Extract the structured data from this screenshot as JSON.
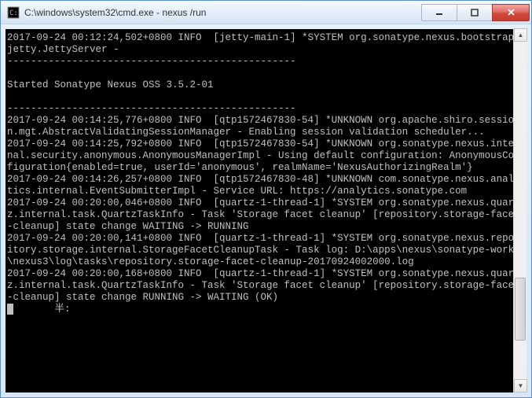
{
  "window": {
    "title": "C:\\windows\\system32\\cmd.exe - nexus  /run"
  },
  "terminal": {
    "lines": [
      "2017-09-24 00:12:24,502+0800 INFO  [jetty-main-1] *SYSTEM org.sonatype.nexus.bootstrap.jetty.JettyServer -",
      "-------------------------------------------------",
      "",
      "Started Sonatype Nexus OSS 3.5.2-01",
      "",
      "-------------------------------------------------",
      "2017-09-24 00:14:25,776+0800 INFO  [qtp1572467830-54] *UNKNOWN org.apache.shiro.session.mgt.AbstractValidatingSessionManager - Enabling session validation scheduler...",
      "2017-09-24 00:14:25,792+0800 INFO  [qtp1572467830-54] *UNKNOWN org.sonatype.nexus.internal.security.anonymous.AnonymousManagerImpl - Using default configuration: AnonymousConfiguration{enabled=true, userId='anonymous', realmName='NexusAuthorizingRealm'}",
      "2017-09-24 00:14:26,257+0800 INFO  [qtp1572467830-48] *UNKNOWN com.sonatype.nexus.analytics.internal.EventSubmitterImpl - Service URL: https://analytics.sonatype.com",
      "2017-09-24 00:20:00,046+0800 INFO  [quartz-1-thread-1] *SYSTEM org.sonatype.nexus.quartz.internal.task.QuartzTaskInfo - Task 'Storage facet cleanup' [repository.storage-facet-cleanup] state change WAITING -> RUNNING",
      "2017-09-24 00:20:00,141+0800 INFO  [quartz-1-thread-1] *SYSTEM org.sonatype.nexus.repository.storage.internal.StorageFacetCleanupTask - Task log: D:\\apps\\nexus\\sonatype-work\\nexus3\\log\\tasks\\repository.storage-facet-cleanup-20170924002000.log",
      "2017-09-24 00:20:00,168+0800 INFO  [quartz-1-thread-1] *SYSTEM org.sonatype.nexus.quartz.internal.task.QuartzTaskInfo - Task 'Storage facet cleanup' [repository.storage-facet-cleanup] state change RUNNING -> WAITING (OK)"
    ],
    "prompt": "       半:"
  }
}
